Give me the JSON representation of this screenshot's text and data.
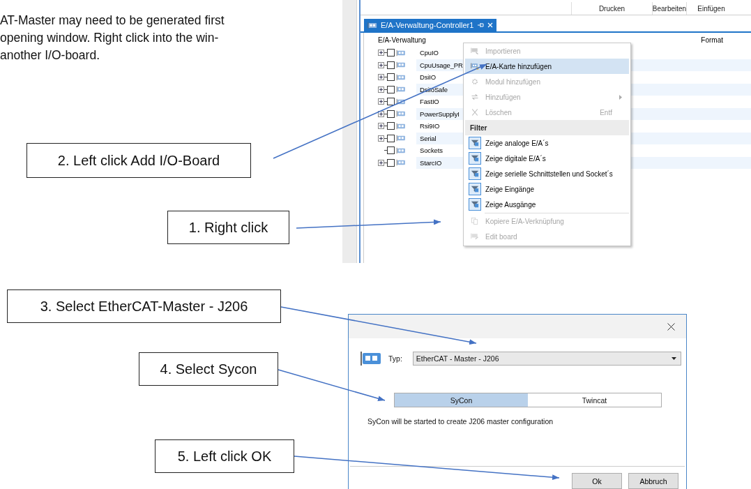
{
  "document": {
    "intro_lines": [
      "AT-Master may need to be generated first",
      "opening window. Right click into the win-",
      "another I/O-board."
    ]
  },
  "io_manager_screenshot": {
    "toolbar": [
      "Drucken",
      "Bearbeiten",
      "Einfügen"
    ],
    "tab": {
      "label": "E/A-Verwaltung-Controller1",
      "selected": true
    },
    "columns": [
      "E/A-Verwaltung",
      "Format"
    ],
    "tree_rows": [
      {
        "label": "CpuIO",
        "expandable": true,
        "checked": false
      },
      {
        "label": "CpuUsage_PR",
        "expandable": true,
        "checked": false
      },
      {
        "label": "DsiIO",
        "expandable": true,
        "checked": false
      },
      {
        "label": "DsiIoSafe",
        "expandable": true,
        "checked": false
      },
      {
        "label": "FastIO",
        "expandable": true,
        "checked": false
      },
      {
        "label": "PowerSupplyI",
        "expandable": true,
        "checked": false
      },
      {
        "label": "Rsi9IO",
        "expandable": true,
        "checked": false
      },
      {
        "label": "Serial",
        "expandable": true,
        "checked": false
      },
      {
        "label": "Sockets",
        "expandable": false,
        "checked": false
      },
      {
        "label": "StarcIO",
        "expandable": true,
        "checked": false
      }
    ],
    "context_menu": {
      "items": [
        {
          "kind": "item",
          "label": "Importieren",
          "disabled": true,
          "selected": false,
          "checked": false
        },
        {
          "kind": "item",
          "label": "E/A-Karte hinzufügen",
          "disabled": false,
          "selected": true,
          "checked": false
        },
        {
          "kind": "item",
          "label": "Modul hinzufügen",
          "disabled": true,
          "selected": false,
          "checked": false
        },
        {
          "kind": "item",
          "label": "Hinzufügen",
          "disabled": true,
          "selected": false,
          "checked": false,
          "submenu": true
        },
        {
          "kind": "item",
          "label": "Löschen",
          "disabled": true,
          "selected": false,
          "checked": false,
          "shortcut": "Entf"
        },
        {
          "kind": "header",
          "label": "Filter"
        },
        {
          "kind": "item",
          "label": "Zeige analoge E/A´s",
          "disabled": false,
          "selected": false,
          "checked": true
        },
        {
          "kind": "item",
          "label": "Zeige digitale E/A´s",
          "disabled": false,
          "selected": false,
          "checked": true
        },
        {
          "kind": "item",
          "label": "Zeige serielle Schnittstellen und Socket´s",
          "disabled": false,
          "selected": false,
          "checked": true
        },
        {
          "kind": "item",
          "label": "Zeige Eingänge",
          "disabled": false,
          "selected": false,
          "checked": true
        },
        {
          "kind": "item",
          "label": "Zeige Ausgänge",
          "disabled": false,
          "selected": false,
          "checked": true
        },
        {
          "kind": "separator"
        },
        {
          "kind": "item",
          "label": "Kopiere E/A-Verknüpfung",
          "disabled": true,
          "selected": false,
          "checked": false
        },
        {
          "kind": "item",
          "label": "Edit board",
          "disabled": true,
          "selected": false,
          "checked": false
        }
      ]
    }
  },
  "board_dialog": {
    "type_label": "Typ:",
    "type_value": "EtherCAT - Master - J206",
    "options": [
      {
        "label": "SyCon",
        "selected": true
      },
      {
        "label": "Twincat",
        "selected": false
      }
    ],
    "message": "SyCon will be started to create J206 master configuration",
    "buttons": [
      "Ok",
      "Abbruch"
    ]
  },
  "callouts": [
    "2. Left click Add I/O-Board",
    "1. Right click",
    "3. Select EtherCAT-Master - J206",
    "4. Select Sycon",
    "5. Left click OK"
  ]
}
